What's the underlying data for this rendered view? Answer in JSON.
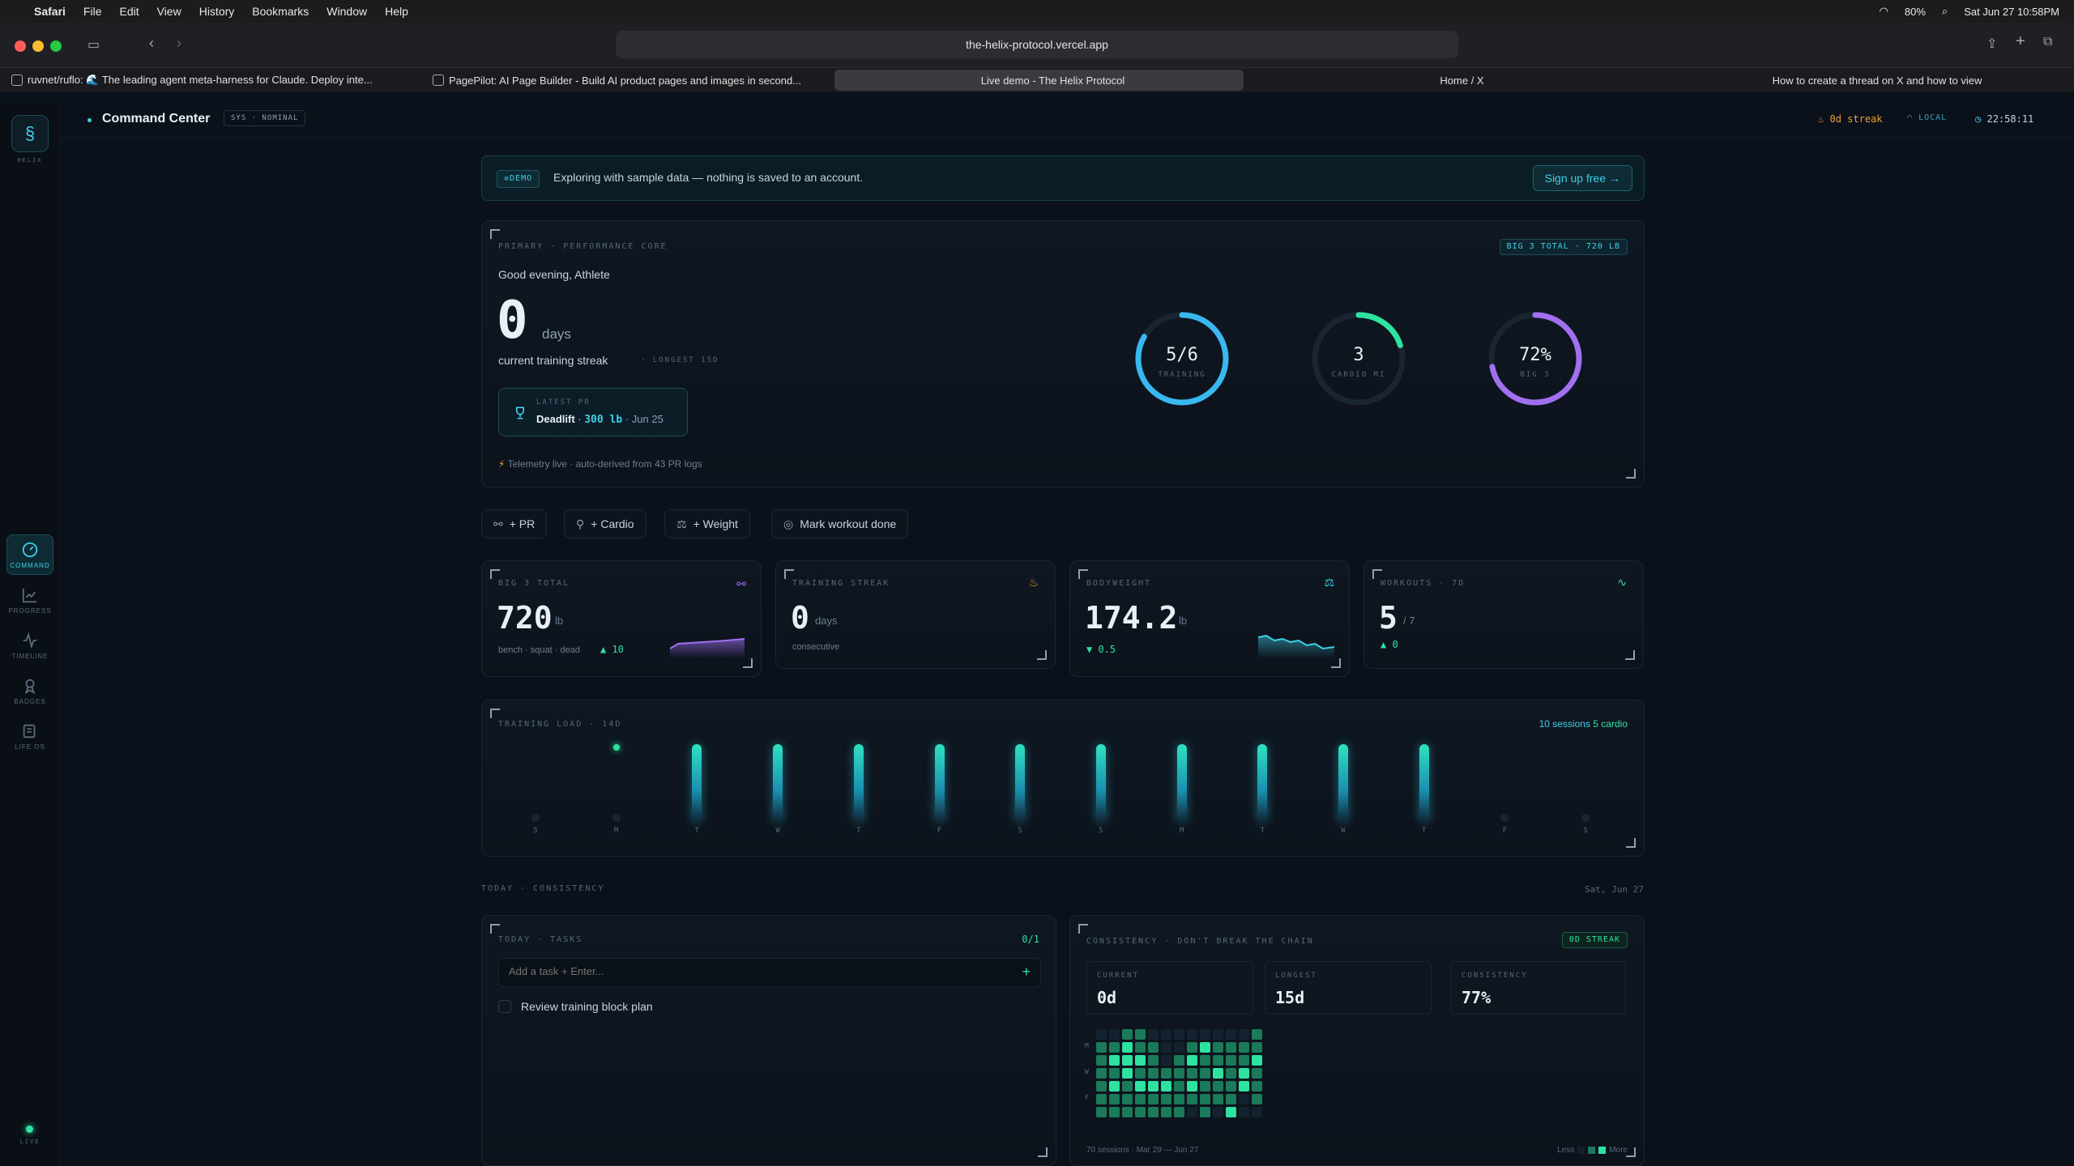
{
  "menubar": {
    "app": "Safari",
    "items": [
      "File",
      "Edit",
      "View",
      "History",
      "Bookmarks",
      "Window",
      "Help"
    ],
    "battery": "80%",
    "datetime": "Sat Jun 27  10:58PM"
  },
  "browser": {
    "url": "the-helix-protocol.vercel.app",
    "tabs": [
      {
        "title": "ruvnet/ruflo: 🌊 The leading agent meta-harness for Claude. Deploy inte...",
        "active": false
      },
      {
        "title": "PagePilot: AI Page Builder - Build AI product pages and images in second...",
        "active": false
      },
      {
        "title": "Live demo - The Helix Protocol",
        "active": true
      },
      {
        "title": "Home / X",
        "active": false
      },
      {
        "title": "How to create a thread on X and how to view",
        "active": false
      }
    ]
  },
  "sidebar": {
    "logo_label": "HELIX",
    "items": [
      {
        "label": "COMMAND",
        "icon": "gauge-icon",
        "active": true
      },
      {
        "label": "PROGRESS",
        "icon": "chart-icon",
        "active": false
      },
      {
        "label": "TIMELINE",
        "icon": "pulse-icon",
        "active": false
      },
      {
        "label": "BADGES",
        "icon": "badge-icon",
        "active": false
      },
      {
        "label": "LIFE OS",
        "icon": "notebook-icon",
        "active": false
      }
    ],
    "live_label": "LIVE"
  },
  "topbar": {
    "title": "Command Center",
    "status": "SYS · NOMINAL",
    "streak": "0d streak",
    "mode": "LOCAL",
    "clock": "22:58:11"
  },
  "banner": {
    "badge": "DEMO",
    "text": "Exploring with sample data — nothing is saved to an account.",
    "cta": "Sign up free →"
  },
  "hero": {
    "label": "PRIMARY · PERFORMANCE CORE",
    "badge": "BIG 3 TOTAL · 720 LB",
    "greeting": "Good evening, Athlete",
    "streak_value": "0",
    "streak_unit": "days",
    "streak_caption": "current training streak",
    "longest": "LONGEST 15D",
    "pr": {
      "label": "LATEST PR",
      "lift": "Deadlift",
      "weight": "300 lb",
      "date": "· Jun 25"
    },
    "telemetry": "Telemetry live · auto-derived from 43 PR logs",
    "rings": [
      {
        "value": "5/6",
        "label": "TRAINING",
        "fraction": 0.8333,
        "color": "#39b8f0"
      },
      {
        "value": "3",
        "label": "CARDIO MI",
        "fraction": 0.2,
        "color": "#2ee3a0"
      },
      {
        "value": "72%",
        "label": "BIG 3",
        "fraction": 0.72,
        "color": "#a070f0"
      }
    ]
  },
  "actions": [
    "+ PR",
    "+ Cardio",
    "+ Weight",
    "Mark workout done"
  ],
  "stats": [
    {
      "label": "BIG 3 TOTAL",
      "value": "720",
      "unit": "lb",
      "sub": "bench · squat · dead",
      "delta": "10",
      "icon": "link-icon"
    },
    {
      "label": "TRAINING STREAK",
      "value": "0",
      "unit": "days",
      "sub": "consecutive",
      "delta": "",
      "icon": "flame-icon"
    },
    {
      "label": "BODYWEIGHT",
      "value": "174.2",
      "unit": "lb",
      "sub": "",
      "delta": "0.5",
      "icon": "scale-icon"
    },
    {
      "label": "WORKOUTS · 7D",
      "value": "5",
      "unit": "/ 7",
      "sub": "",
      "delta": "0",
      "icon": "pulse-icon"
    }
  ],
  "load": {
    "label": "TRAINING LOAD · 14D",
    "sessions": "10 sessions",
    "cardio": "5 cardio",
    "days": [
      "S",
      "M",
      "T",
      "W",
      "T",
      "F",
      "S",
      "S",
      "M",
      "T",
      "W",
      "T",
      "F",
      "S"
    ],
    "values": [
      0,
      0.05,
      1,
      1,
      1,
      1,
      1,
      1,
      1,
      1,
      1,
      1,
      0,
      0
    ]
  },
  "section": {
    "label": "TODAY · CONSISTENCY",
    "date": "Sat, Jun 27"
  },
  "tasks": {
    "label": "TODAY · TASKS",
    "count": "0/1",
    "placeholder": "Add a task + Enter...",
    "items": [
      "Review training block plan"
    ]
  },
  "consistency": {
    "label": "CONSISTENCY · DON'T BREAK THE CHAIN",
    "badge": "0D STREAK",
    "stats": [
      {
        "label": "CURRENT",
        "value": "0d"
      },
      {
        "label": "LONGEST",
        "value": "15d"
      },
      {
        "label": "CONSISTENCY",
        "value": "77%"
      }
    ],
    "row_labels": [
      "M",
      "",
      "W",
      "",
      "F",
      ""
    ],
    "footer": "70 sessions · Mar 29 — Jun 27",
    "less": "Less",
    "more": "More"
  }
}
